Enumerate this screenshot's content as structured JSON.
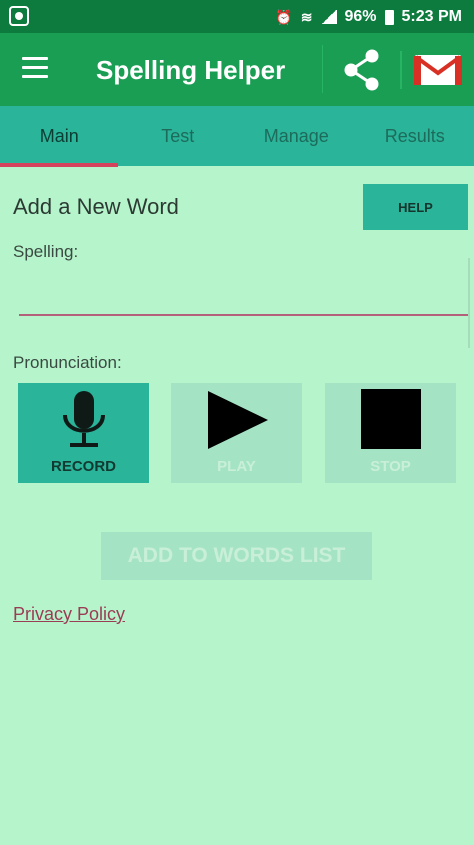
{
  "status_bar": {
    "battery": "96%",
    "time": "5:23 PM",
    "network_icon": "wifi-icon",
    "signal_icon": "signal-icon",
    "battery_icon": "battery-icon",
    "alarm_icon": "alarm-icon",
    "app_icon": "shield-icon"
  },
  "app_bar": {
    "title": "Spelling Helper",
    "menu_icon": "hamburger-menu-icon",
    "share_icon": "share-icon",
    "mail_icon": "gmail-icon"
  },
  "tabs": [
    {
      "label": "Main",
      "active": true
    },
    {
      "label": "Test",
      "active": false
    },
    {
      "label": "Manage",
      "active": false
    },
    {
      "label": "Results",
      "active": false
    }
  ],
  "main": {
    "section_title": "Add a New Word",
    "help_label": "HELP",
    "spelling_label": "Spelling:",
    "spelling_value": "",
    "pronunciation_label": "Pronunciation:",
    "buttons": {
      "record": "RECORD",
      "play": "PLAY",
      "stop": "STOP"
    },
    "add_to_list_label": "ADD TO WORDS LIST",
    "privacy_label": "Privacy Policy"
  },
  "colors": {
    "status_bar": "#0d7a3e",
    "app_bar": "#1a9e54",
    "tab_bar": "#2ab49a",
    "background": "#b6f5cb",
    "tab_indicator": "#d5425c",
    "disabled_button": "#a4e4c4"
  }
}
